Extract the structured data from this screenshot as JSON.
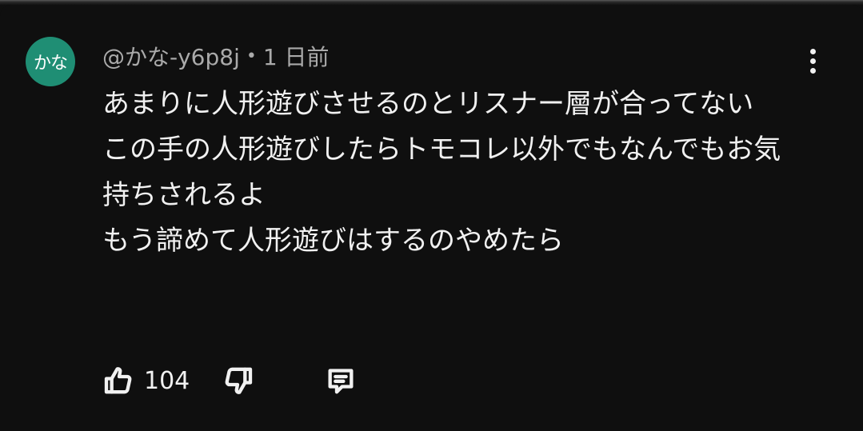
{
  "comment": {
    "avatar_text": "かな",
    "author": "@かな-y6p8j",
    "separator": "•",
    "time": "1 日前",
    "text": "あまりに人形遊びさせるのとリスナー層が合ってない\nこの手の人形遊びしたらトモコレ以外でもなんでもお気持ちされるよ\nもう諦めて人形遊びはするのやめたら",
    "like_count": "104"
  },
  "colors": {
    "background": "#0f0f0f",
    "avatar": "#1f8e74",
    "text": "#f1f1f1",
    "meta_text": "#aaaaaa"
  },
  "icons": {
    "like": "thumbs-up-icon",
    "dislike": "thumbs-down-icon",
    "reply": "comment-icon",
    "more": "more-vertical-icon"
  }
}
